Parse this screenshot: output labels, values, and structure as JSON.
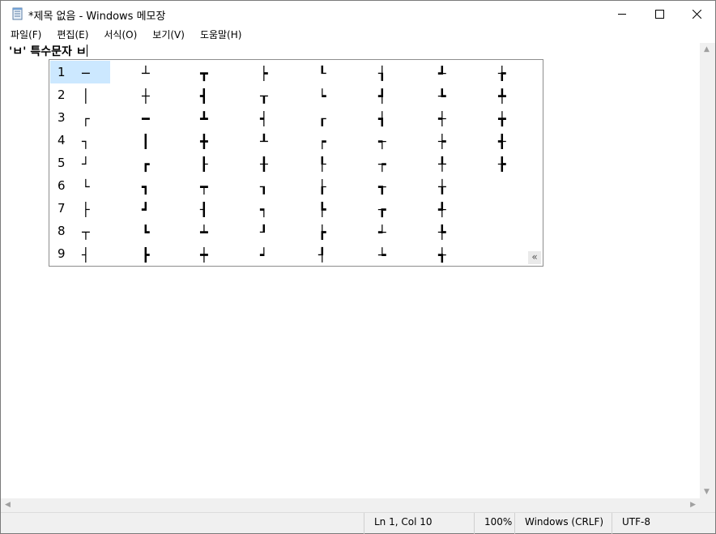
{
  "window": {
    "title": "*제목 없음 - Windows 메모장"
  },
  "menu": [
    "파일(F)",
    "편집(E)",
    "서식(O)",
    "보기(V)",
    "도움말(H)"
  ],
  "editor": {
    "text": "'ㅂ' 특수문자 ㅂ"
  },
  "candidates": {
    "numbers": [
      "1",
      "2",
      "3",
      "4",
      "5",
      "6",
      "7",
      "8",
      "9"
    ],
    "columns": [
      [
        "─",
        "│",
        "┌",
        "┐",
        "┘",
        "└",
        "├",
        "┬",
        "┤"
      ],
      [
        "┴",
        "┼",
        "━",
        "┃",
        "┏",
        "┓",
        "┛",
        "┗",
        "┣"
      ],
      [
        "┳",
        "┫",
        "┻",
        "╋",
        "┠",
        "┯",
        "┨",
        "┷",
        "┿"
      ],
      [
        "┝",
        "┰",
        "┥",
        "┸",
        "╂",
        "┒",
        "┑",
        "┚",
        "┙"
      ],
      [
        "┖",
        "┕",
        "┎",
        "┍",
        "┞",
        "┟",
        "┡",
        "┢",
        "┦"
      ],
      [
        "┧",
        "┩",
        "┪",
        "┭",
        "┮",
        "┱",
        "┲",
        "┵",
        "┶"
      ],
      [
        "┹",
        "┺",
        "┽",
        "┾",
        "╀",
        "╁",
        "╃",
        "╄",
        "╅"
      ],
      [
        "╆",
        "╇",
        "╈",
        "╉",
        "╊"
      ]
    ],
    "more_symbol": "«"
  },
  "status": {
    "position": "Ln 1, Col 10",
    "zoom": "100%",
    "line_ending": "Windows (CRLF)",
    "encoding": "UTF-8"
  }
}
